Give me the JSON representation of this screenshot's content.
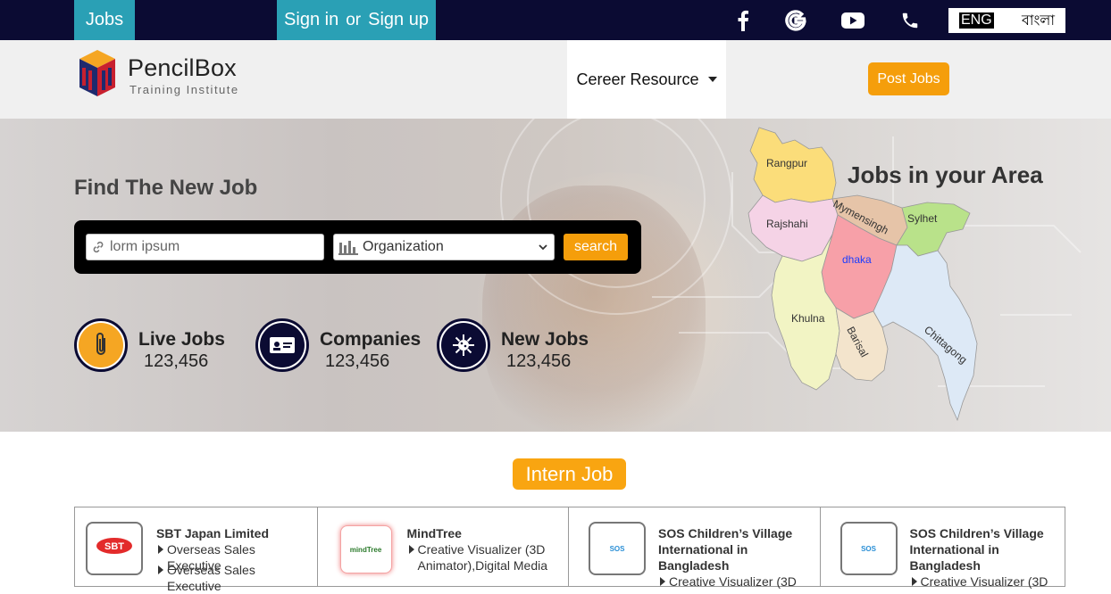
{
  "topbar": {
    "jobs_label": "Jobs",
    "signin_label": "Sign in",
    "or_label": "or",
    "signup_label": "Sign up",
    "social_icons": [
      "facebook-icon",
      "google-icon",
      "youtube-icon",
      "phone-icon"
    ],
    "lang_eng": "ENG",
    "lang_bn": "বাংলা"
  },
  "header": {
    "logo_name": "PencilBox",
    "logo_sub": "Training Institute",
    "career_label": "Cereer Resource",
    "post_jobs_label": "Post Jobs"
  },
  "hero": {
    "title": "Find The New Job",
    "search_value": "lorm ipsum",
    "org_value": "Organization",
    "search_button": "search",
    "stats": [
      {
        "label": "Live Jobs",
        "count": "123,456"
      },
      {
        "label": "Companies",
        "count": "123,456"
      },
      {
        "label": "New Jobs",
        "count": "123,456"
      }
    ],
    "map_title": "Jobs in your Area",
    "regions": {
      "rangpur": "Rangpur",
      "rajshahi": "Rajshahi",
      "mymensingh": "Mymensingh",
      "sylhet": "Sylhet",
      "dhaka": "dhaka",
      "khulna": "Khulna",
      "barisal": "Barisal",
      "chittagong": "Chittagong"
    }
  },
  "intern": {
    "button_label": "Intern Job",
    "cards": [
      {
        "name": "SBT Japan Limited",
        "positions": [
          "Overseas Sales Executive",
          "Overseas Sales Executive"
        ],
        "logo_text": "SBT"
      },
      {
        "name": "MindTree",
        "positions": [
          "Creative Visualizer (3D Animator),Digital Media"
        ],
        "logo_text": "mindTree"
      },
      {
        "name": "SOS Children’s Village International in Bangladesh",
        "positions": [
          "Creative Visualizer (3D"
        ],
        "logo_text": "SOS"
      },
      {
        "name": "SOS Children’s Village International in Bangladesh",
        "positions": [
          "Creative Visualizer (3D"
        ],
        "logo_text": "SOS"
      }
    ]
  },
  "colors": {
    "navy": "#0b0b33",
    "teal": "#2aa0b5",
    "orange": "#f59e0b"
  }
}
